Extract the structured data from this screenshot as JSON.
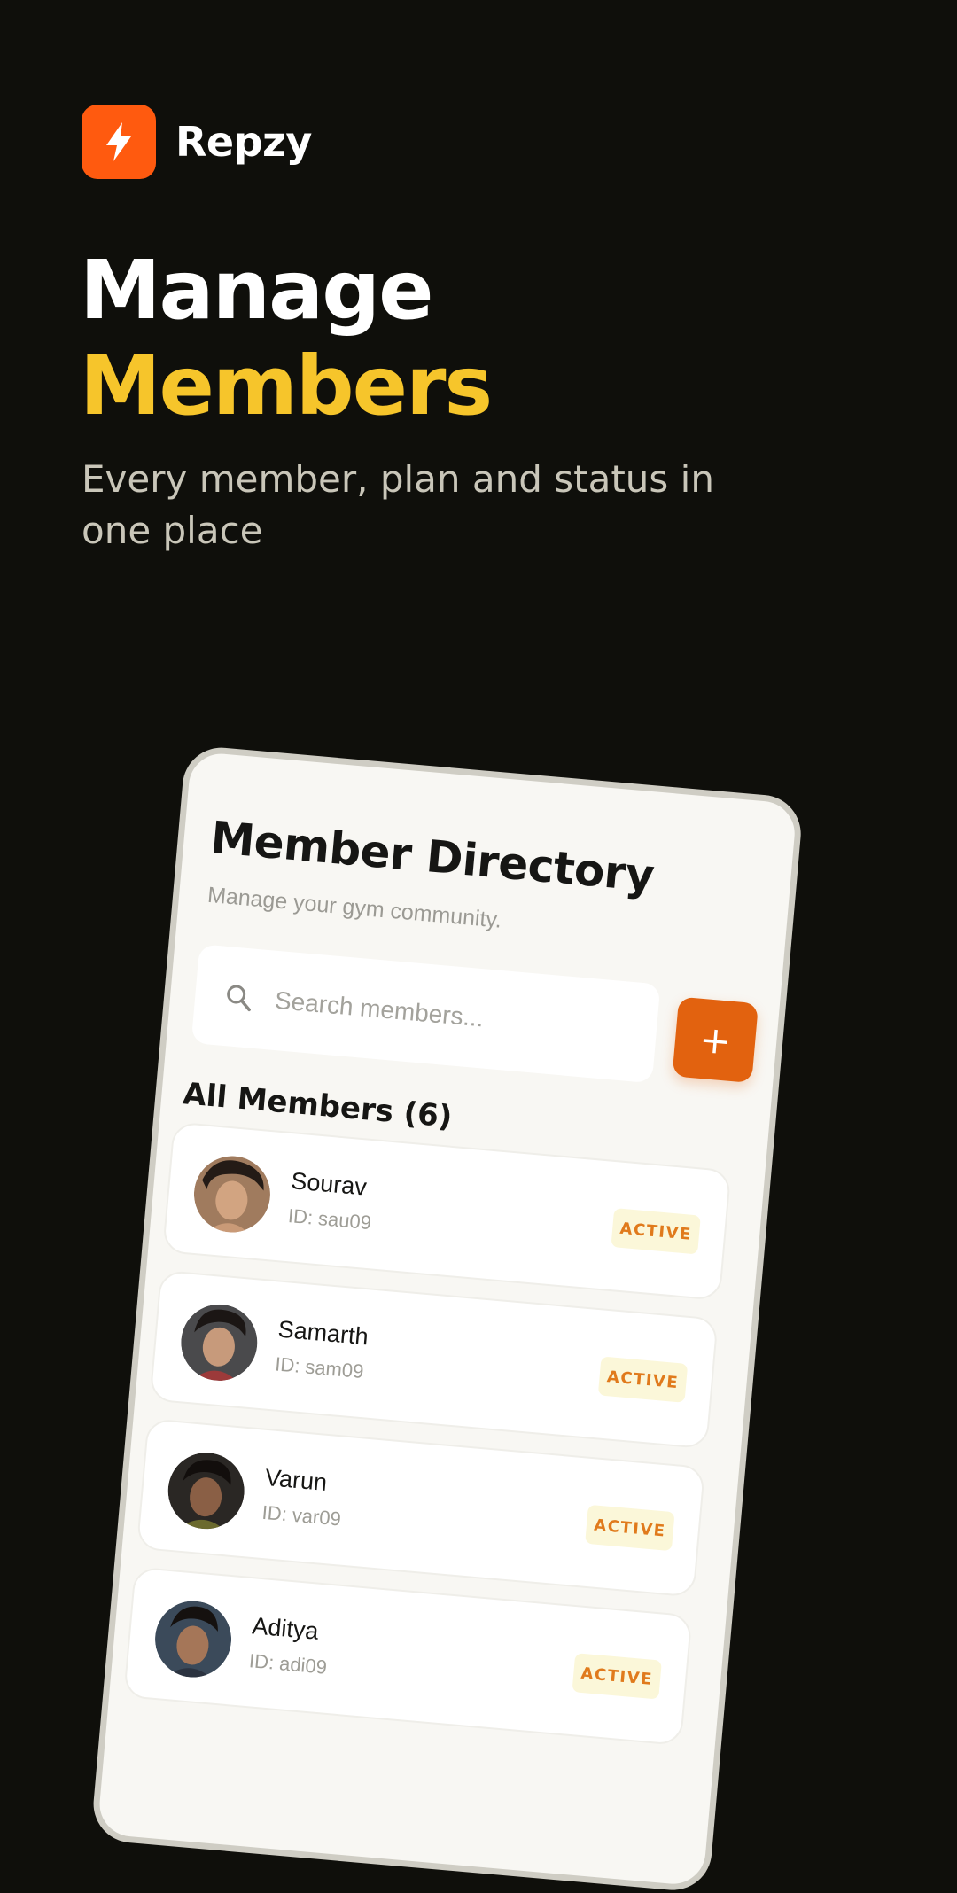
{
  "brand": {
    "name": "Repzy",
    "icon": "bolt-icon",
    "color": "#ff5a0f"
  },
  "hero": {
    "line1": "Manage",
    "line2": "Members",
    "subtitle": "Every member, plan and status in one place",
    "accent_color": "#f6c52b"
  },
  "screen": {
    "title": "Member Directory",
    "subtitle": "Manage your gym community.",
    "search": {
      "placeholder": "Search members...",
      "icon": "search-icon"
    },
    "add_button": {
      "label": "+",
      "color": "#e2620f"
    },
    "section_title": "All Members (6)",
    "members": [
      {
        "name": "Sourav",
        "id": "ID: sau09",
        "status": "ACTIVE"
      },
      {
        "name": "Samarth",
        "id": "ID: sam09",
        "status": "ACTIVE"
      },
      {
        "name": "Varun",
        "id": "ID: var09",
        "status": "ACTIVE"
      },
      {
        "name": "Aditya",
        "id": "ID: adi09",
        "status": "ACTIVE"
      }
    ]
  },
  "colors": {
    "background": "#0f0f0b",
    "badge_bg": "#fbf7d9",
    "badge_text": "#e07a1c"
  }
}
